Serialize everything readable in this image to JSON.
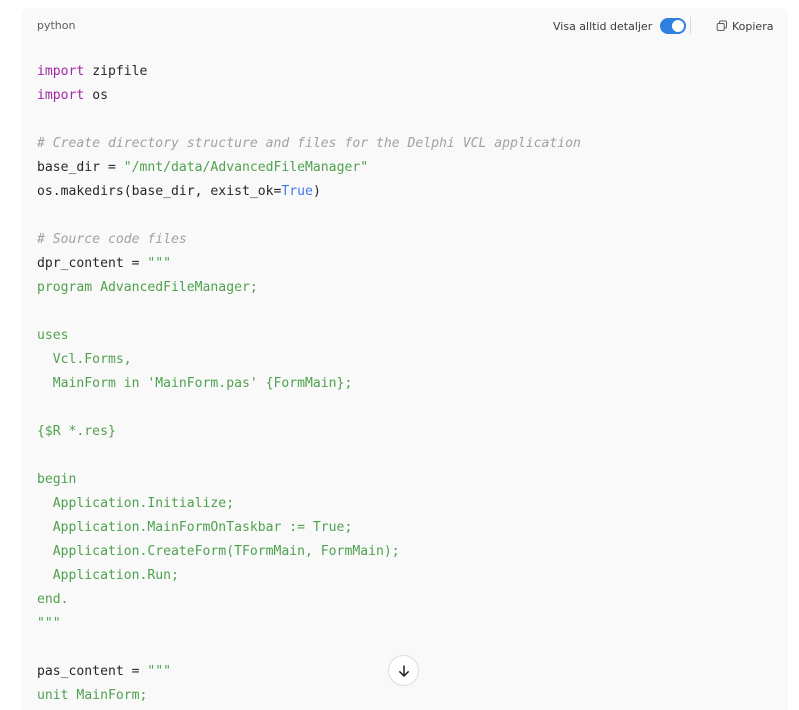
{
  "code_block": {
    "language": "python",
    "details_toggle_label": "Visa alltid detaljer",
    "details_toggle_on": true,
    "copy_label": "Kopiera",
    "toggle_color": "#2f7fe0"
  },
  "code_lines": [
    [
      [
        "kw",
        "import"
      ],
      [
        "pl",
        " zipfile"
      ]
    ],
    [
      [
        "kw",
        "import"
      ],
      [
        "pl",
        " os"
      ]
    ],
    [],
    [
      [
        "com",
        "# Create directory structure and files for the Delphi VCL application"
      ]
    ],
    [
      [
        "pl",
        "base_dir = "
      ],
      [
        "str",
        "\"/mnt/data/AdvancedFileManager\""
      ]
    ],
    [
      [
        "pl",
        "os.makedirs(base_dir, exist_ok="
      ],
      [
        "lit",
        "True"
      ],
      [
        "pl",
        ")"
      ]
    ],
    [],
    [
      [
        "com",
        "# Source code files"
      ]
    ],
    [
      [
        "pl",
        "dpr_content = "
      ],
      [
        "str",
        "\"\"\""
      ]
    ],
    [
      [
        "str",
        "program AdvancedFileManager;"
      ]
    ],
    [],
    [
      [
        "str",
        "uses"
      ]
    ],
    [
      [
        "str",
        "  Vcl.Forms,"
      ]
    ],
    [
      [
        "str",
        "  MainForm in 'MainForm.pas' {FormMain};"
      ]
    ],
    [],
    [
      [
        "str",
        "{$R *.res}"
      ]
    ],
    [],
    [
      [
        "str",
        "begin"
      ]
    ],
    [
      [
        "str",
        "  Application.Initialize;"
      ]
    ],
    [
      [
        "str",
        "  Application.MainFormOnTaskbar := True;"
      ]
    ],
    [
      [
        "str",
        "  Application.CreateForm(TFormMain, FormMain);"
      ]
    ],
    [
      [
        "str",
        "  Application.Run;"
      ]
    ],
    [
      [
        "str",
        "end."
      ]
    ],
    [
      [
        "str",
        "\"\"\""
      ]
    ],
    [],
    [
      [
        "pl",
        "pas_content = "
      ],
      [
        "str",
        "\"\"\""
      ]
    ],
    [
      [
        "str",
        "unit MainForm;"
      ]
    ]
  ],
  "icons": {
    "copy": "copy-icon",
    "scroll": "arrow-down-icon"
  }
}
